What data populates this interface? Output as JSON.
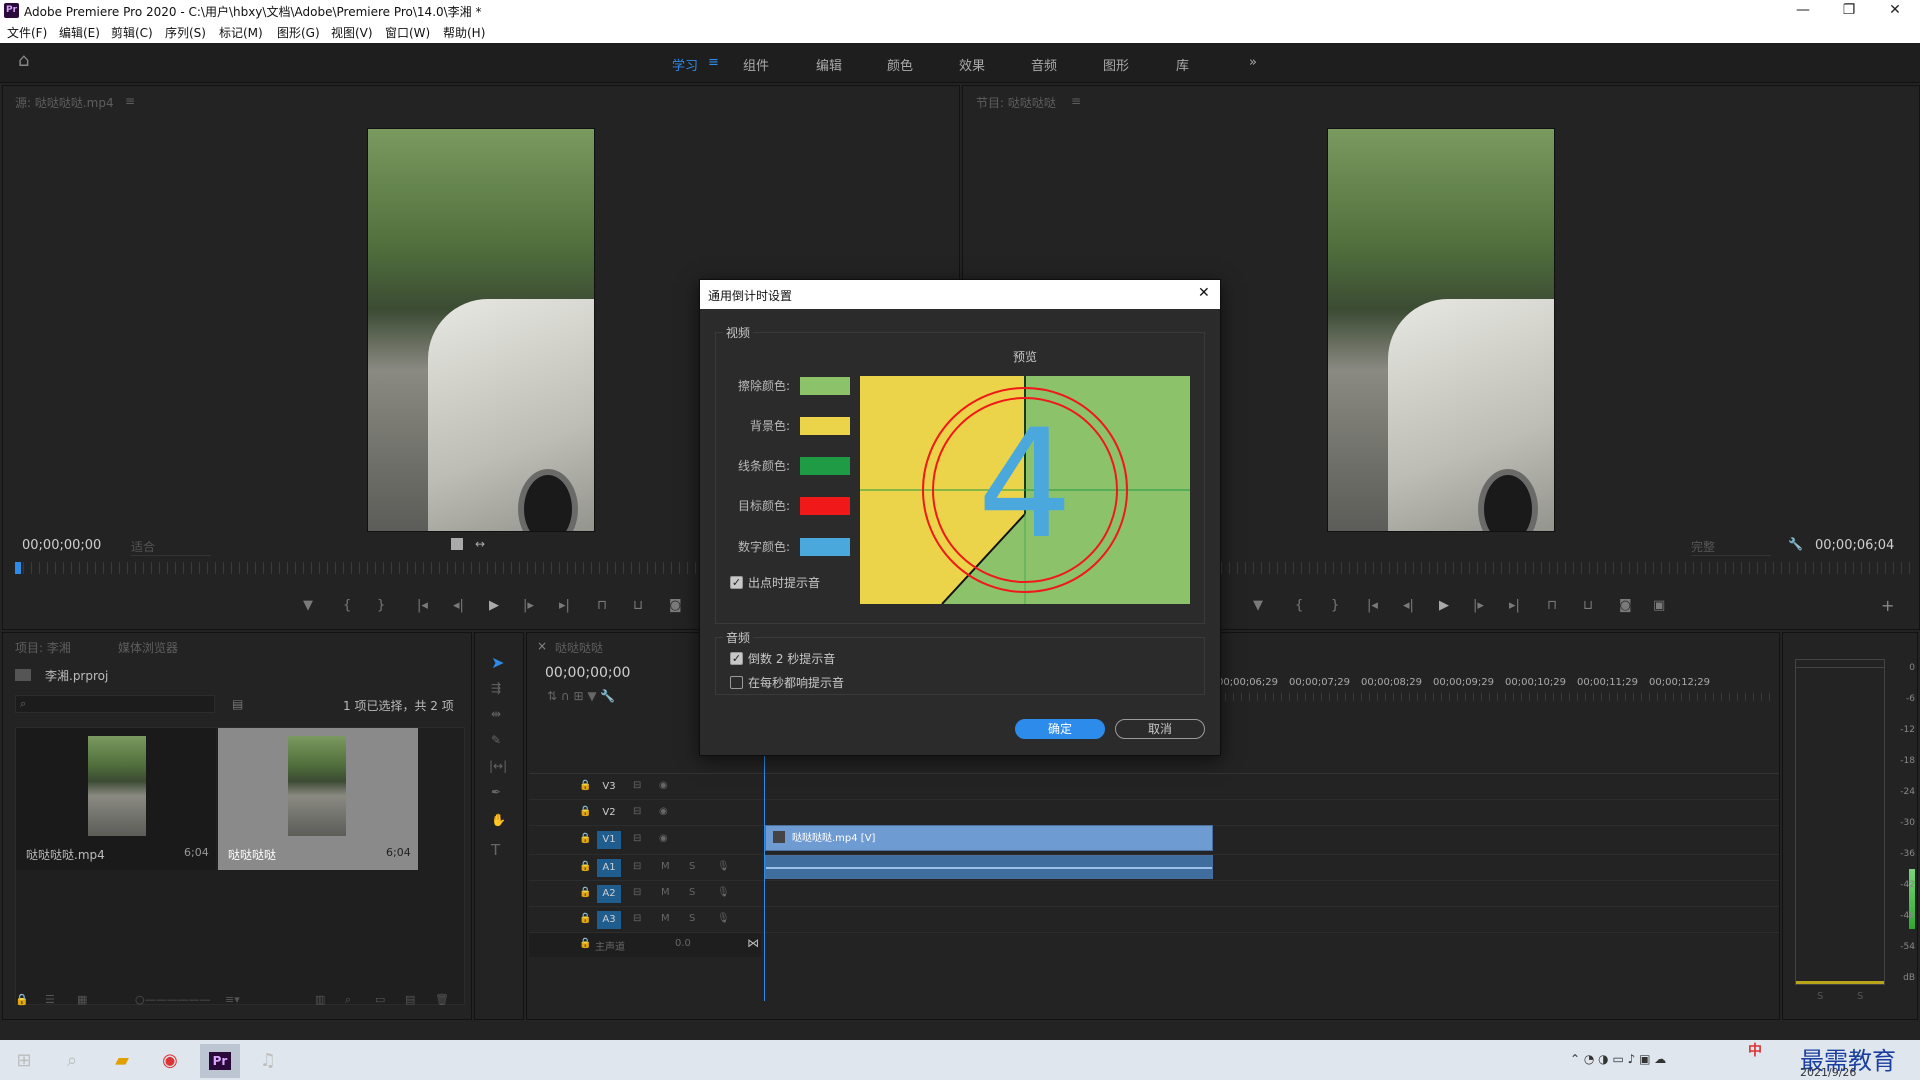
{
  "window": {
    "title": "Adobe Premiere Pro 2020 - C:\\用户\\hbxy\\文档\\Adobe\\Premiere Pro\\14.0\\李湘 *",
    "logo": "Pr",
    "minimize": "—",
    "restore": "❐",
    "close": "✕"
  },
  "menu": [
    "文件(F)",
    "编辑(E)",
    "剪辑(C)",
    "序列(S)",
    "标记(M)",
    "图形(G)",
    "视图(V)",
    "窗口(W)",
    "帮助(H)"
  ],
  "workspaces": {
    "items": [
      "学习",
      "组件",
      "编辑",
      "颜色",
      "效果",
      "音频",
      "图形",
      "库"
    ],
    "active": "学习",
    "more": "»",
    "home_icon": "⌂"
  },
  "source": {
    "title": "源: 哒哒哒哒.mp4",
    "timecode": "00;00;00;00",
    "fit": "适合"
  },
  "program": {
    "title": "节目: 哒哒哒哒",
    "timecode": "00;00;06;04",
    "quality": "完整"
  },
  "project": {
    "tab1": "项目: 李湘",
    "tab2": "媒体浏览器",
    "file": "李湘.prproj",
    "selection": "1 项已选择，共 2 项",
    "items": [
      {
        "name": "哒哒哒哒.mp4",
        "duration": "6;04"
      },
      {
        "name": "哒哒哒哒",
        "duration": "6;04"
      }
    ]
  },
  "timeline": {
    "tab": "哒哒哒哒",
    "timecode": "00;00;00;00",
    "ruler": [
      "00;00;06;29",
      "00;00;07;29",
      "00;00;08;29",
      "00;00;09;29",
      "00;00;10;29",
      "00;00;11;29",
      "00;00;12;29"
    ],
    "video_tracks": [
      "V3",
      "V2",
      "V1"
    ],
    "audio_tracks": [
      "A1",
      "A2",
      "A3"
    ],
    "master": "主声道",
    "master_val": "0.0",
    "clip_label": "哒哒哒哒.mp4 [V]",
    "ms": [
      "M",
      "S"
    ]
  },
  "meter": {
    "labels": [
      "0",
      "-6",
      "-12",
      "-18",
      "-24",
      "-30",
      "-36",
      "-42",
      "-48",
      "-54",
      "dB"
    ],
    "s": "S"
  },
  "dialog": {
    "title": "通用倒计时设置",
    "close": "✕",
    "video_legend": "视频",
    "preview_label": "预览",
    "rows": [
      {
        "label": "擦除颜色:",
        "color": "#8cc36a"
      },
      {
        "label": "背景色:",
        "color": "#ecd44a"
      },
      {
        "label": "线条颜色:",
        "color": "#1f9b45"
      },
      {
        "label": "目标颜色:",
        "color": "#f01818"
      },
      {
        "label": "数字颜色:",
        "color": "#4aa8dd"
      }
    ],
    "cue_out": "出点时提示音",
    "audio_legend": "音频",
    "cue_2s": "倒数 2 秒提示音",
    "cue_each": "在每秒都响提示音",
    "ok": "确定",
    "cancel": "取消",
    "digit": "4"
  },
  "taskbar": {
    "date": "2021/9/26",
    "ime": "中",
    "watermark": "最需教育"
  },
  "colors": {
    "accent": "#2d8ceb",
    "clip": "#6f9bd3"
  }
}
